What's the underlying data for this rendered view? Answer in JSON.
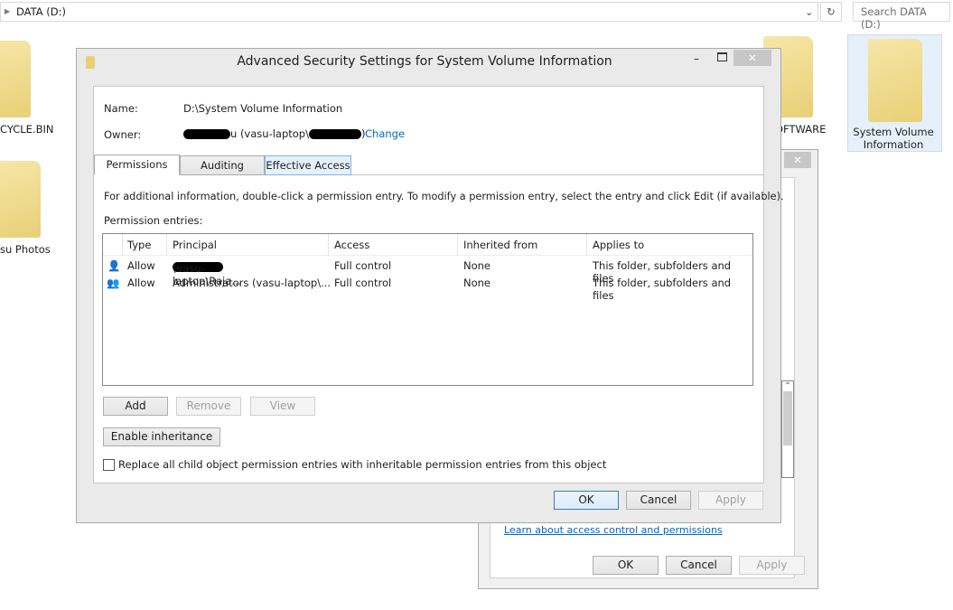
{
  "explorer": {
    "breadcrumb": "DATA (D:)",
    "search_placeholder": "Search DATA (D:)",
    "items": [
      "CYCLE.BIN",
      "su Photos",
      "OFTWARE",
      "System Volume Information"
    ]
  },
  "back_dialog": {
    "link": "Learn about access control and permissions",
    "ok": "OK",
    "cancel": "Cancel",
    "apply": "Apply"
  },
  "dialog": {
    "title": "Advanced Security Settings for System Volume Information",
    "name_label": "Name:",
    "name_value": "D:\\System Volume Information",
    "owner_label": "Owner:",
    "owner_value_visible": "u (vasu-laptop\\",
    "owner_value_end": ")",
    "change_link": "Change",
    "tabs": [
      "Permissions",
      "Auditing",
      "Effective Access"
    ],
    "info_text": "For additional information, double-click a permission entry. To modify a permission entry, select the entry and click Edit (if available).",
    "entries_label": "Permission entries:",
    "columns": [
      "Type",
      "Principal",
      "Access",
      "Inherited from",
      "Applies to"
    ],
    "rows": [
      {
        "icon": "user-icon",
        "type": "Allow",
        "principal": "(vasu-laptop\\Raja...",
        "access": "Full control",
        "inherited": "None",
        "applies": "This folder, subfolders and files"
      },
      {
        "icon": "group-icon",
        "type": "Allow",
        "principal": "Administrators (vasu-laptop\\...",
        "access": "Full control",
        "inherited": "None",
        "applies": "This folder, subfolders and files"
      }
    ],
    "add": "Add",
    "remove": "Remove",
    "view": "View",
    "enable_inheritance": "Enable inheritance",
    "replace_checkbox": "Replace all child object permission entries with inheritable permission entries from this object",
    "replace_checked": false,
    "ok": "OK",
    "cancel": "Cancel",
    "apply": "Apply",
    "link_color": "#0066cc"
  }
}
